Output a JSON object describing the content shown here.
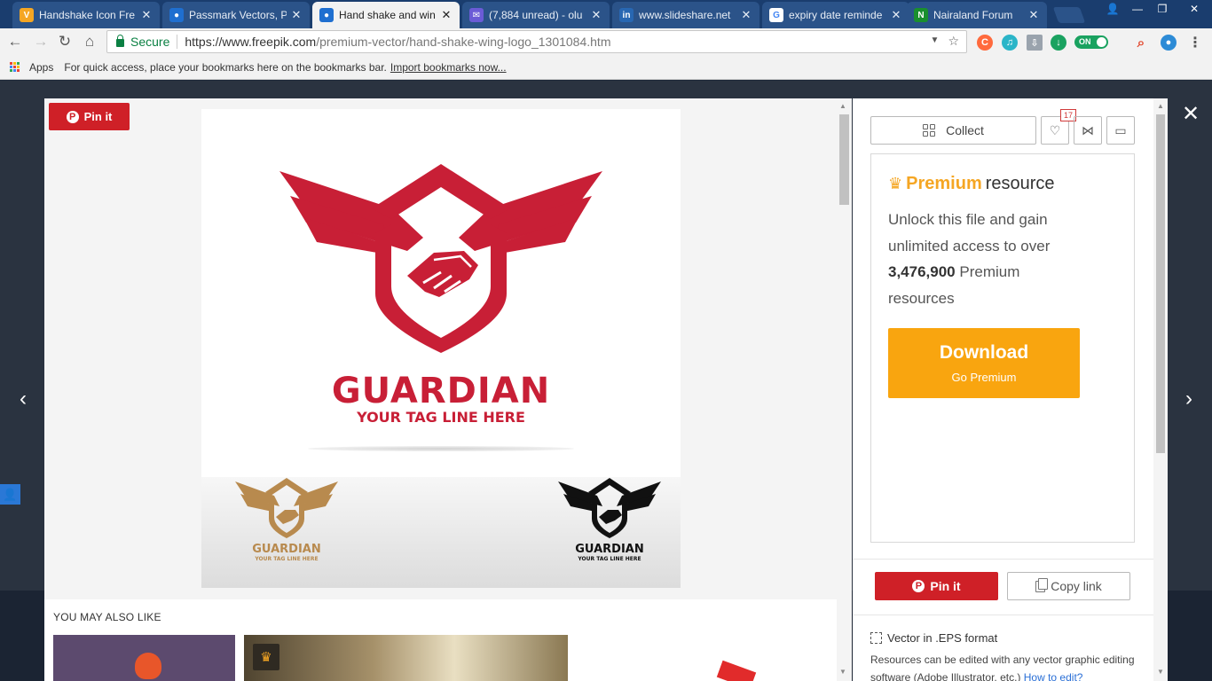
{
  "browser": {
    "tabs": [
      {
        "title": "Handshake Icon Fre",
        "favicon": "V",
        "favicon_color": "#f5a623"
      },
      {
        "title": "Passmark Vectors, P",
        "favicon": "freepik-icon",
        "favicon_color": "#1f6fd0"
      },
      {
        "title": "Hand shake and win",
        "favicon": "freepik-icon",
        "favicon_color": "#1f6fd0"
      },
      {
        "title": "(7,884 unread) - olu",
        "favicon": "mail-icon",
        "favicon_color": "#6b5bd6"
      },
      {
        "title": "www.slideshare.net",
        "favicon": "in",
        "favicon_color": "#2867b2"
      },
      {
        "title": "expiry date reminde",
        "favicon": "G",
        "favicon_color": "#ffffff"
      },
      {
        "title": "Nairaland Forum",
        "favicon": "N",
        "favicon_color": "#1a8f2e"
      }
    ],
    "active_tab": 2,
    "secure_label": "Secure",
    "url_host": "https://www.freepik.com",
    "url_path": "/premium-vector/hand-shake-wing-logo_1301084.htm",
    "ext_toggle_label": "ON",
    "bookmarks": {
      "apps_label": "Apps",
      "hint": "For quick access, place your bookmarks here on the bookmarks bar.",
      "import_link": "Import bookmarks now..."
    }
  },
  "modal": {
    "pin_label": "Pin it",
    "preview": {
      "brand_name": "GUARDIAN",
      "tagline": "YOUR TAG LINE HERE",
      "mini_brand": "GUARDIAN",
      "mini_tagline": "YOUR TAG LINE HERE",
      "colors": {
        "red": "#c81f36",
        "gold": "#b88a4e",
        "black": "#111111"
      }
    },
    "also_like_heading": "YOU MAY ALSO LIKE"
  },
  "panel": {
    "collect_label": "Collect",
    "like_count": "17",
    "premium_word": "Premium",
    "resource_word": "resource",
    "unlock_text_1": "Unlock this file and gain unlimited access to over",
    "premium_count": "3,476,900",
    "unlock_text_2": "Premium resources",
    "download_label": "Download",
    "go_premium_label": "Go Premium",
    "pin_label": "Pin it",
    "copy_link_label": "Copy link",
    "format_label": "Vector in .EPS format",
    "format_note": "Resources can be edited with any vector graphic editing software (Adobe Illustrator, etc.)",
    "how_to_edit": "How to edit?",
    "accent_color": "#f9a50f",
    "pinterest_color": "#cf2027"
  }
}
